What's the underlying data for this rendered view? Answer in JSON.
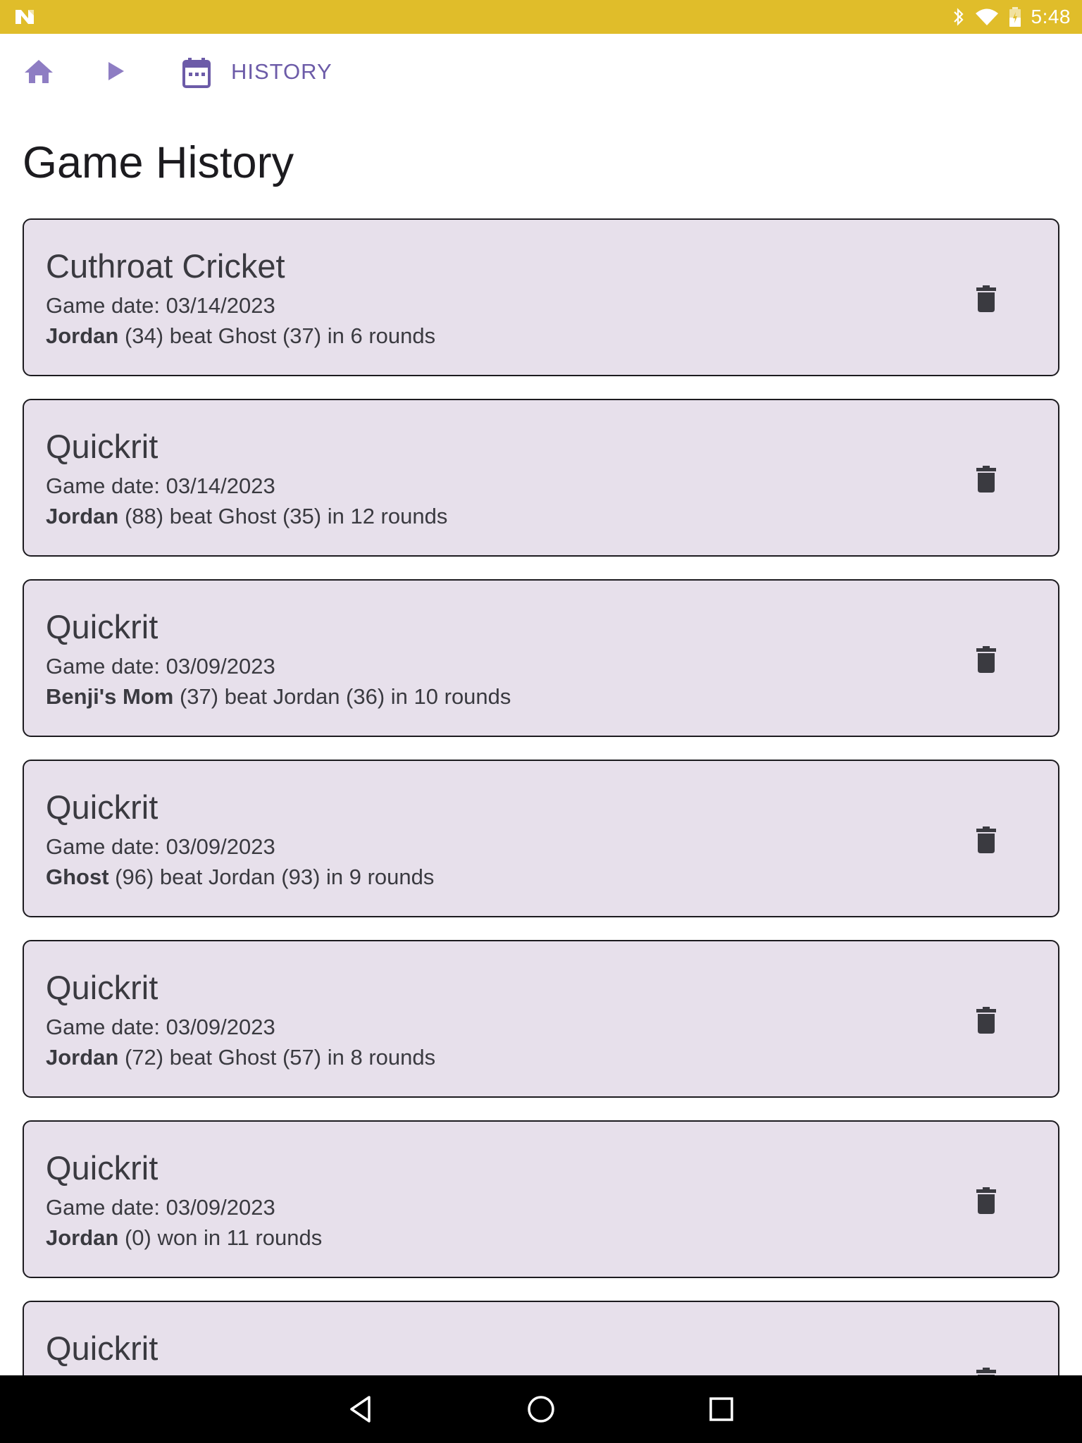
{
  "status_bar": {
    "time": "5:48",
    "background": "#E0BD2A",
    "icons": [
      "n-logo-icon",
      "bluetooth-icon",
      "wifi-icon",
      "battery-icon"
    ]
  },
  "breadcrumb": {
    "items": [
      {
        "icon": "home-icon"
      },
      {
        "icon": "play-arrow-icon"
      },
      {
        "icon": "calendar-icon",
        "label": "HISTORY"
      }
    ],
    "accent": "#6C5BA8"
  },
  "page": {
    "title": "Game History"
  },
  "games": [
    {
      "title": "Cuthroat Cricket",
      "date": "Game date: 03/14/2023",
      "winner": "Jordan",
      "result": " (34) beat Ghost (37) in 6 rounds"
    },
    {
      "title": "Quickrit",
      "date": "Game date: 03/14/2023",
      "winner": "Jordan",
      "result": " (88) beat Ghost (35) in 12 rounds"
    },
    {
      "title": "Quickrit",
      "date": "Game date: 03/09/2023",
      "winner": "Benji's Mom",
      "result": " (37) beat Jordan (36) in 10 rounds"
    },
    {
      "title": "Quickrit",
      "date": "Game date: 03/09/2023",
      "winner": "Ghost",
      "result": " (96) beat Jordan (93) in 9 rounds"
    },
    {
      "title": "Quickrit",
      "date": "Game date: 03/09/2023",
      "winner": "Jordan",
      "result": " (72) beat Ghost (57) in 8 rounds"
    },
    {
      "title": "Quickrit",
      "date": "Game date: 03/09/2023",
      "winner": "Jordan",
      "result": " (0) won in 11 rounds"
    },
    {
      "title": "Quickrit",
      "date": "",
      "winner": "",
      "result": ""
    }
  ],
  "card_style": {
    "background": "#E7E0EB",
    "border": "#1c1b1f"
  },
  "nav_bar": {
    "buttons": [
      "back-icon",
      "home-circle-icon",
      "recents-icon"
    ]
  }
}
